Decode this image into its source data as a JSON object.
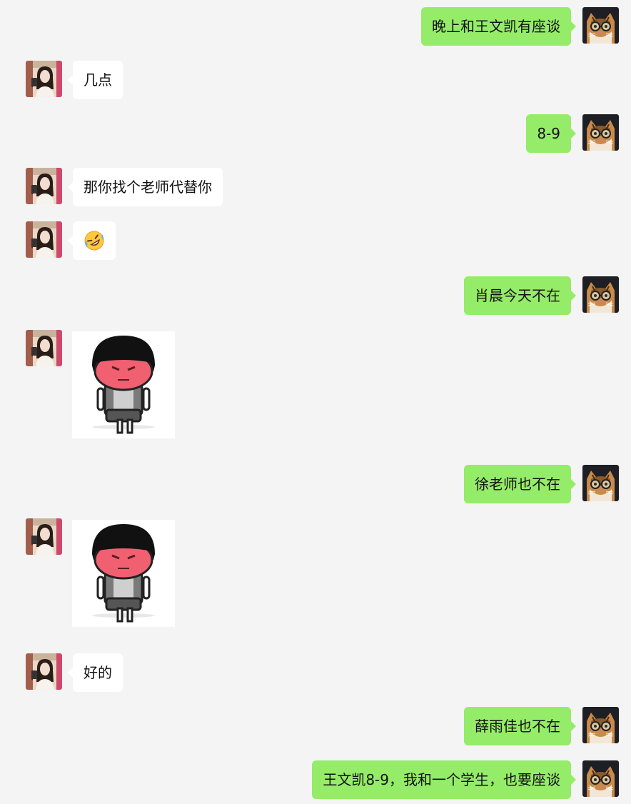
{
  "messages": [
    {
      "side": "out",
      "text": "晚上和王文凯有座谈"
    },
    {
      "side": "in",
      "text": "几点"
    },
    {
      "side": "out",
      "text": "8-9"
    },
    {
      "side": "in",
      "text": "那你找个老师代替你"
    },
    {
      "side": "in",
      "emoji": "rolling-on-floor-laughing-emoji"
    },
    {
      "side": "out",
      "text": "肖晨今天不在"
    },
    {
      "side": "in",
      "sticker": "cartoon-kid-sticker"
    },
    {
      "side": "out",
      "text": "徐老师也不在"
    },
    {
      "side": "in",
      "sticker": "cartoon-kid-sticker"
    },
    {
      "side": "in",
      "text": "好的"
    },
    {
      "side": "out",
      "text": "薛雨佳也不在"
    },
    {
      "side": "out",
      "text": "王文凯8-9，我和一个学生，也要座谈"
    }
  ],
  "avatars": {
    "self": "cat-with-glasses-avatar",
    "contact": "girl-selfie-avatar"
  },
  "colors": {
    "background": "#f4f4f4",
    "outgoing_bubble": "#95ec69",
    "incoming_bubble": "#ffffff"
  }
}
